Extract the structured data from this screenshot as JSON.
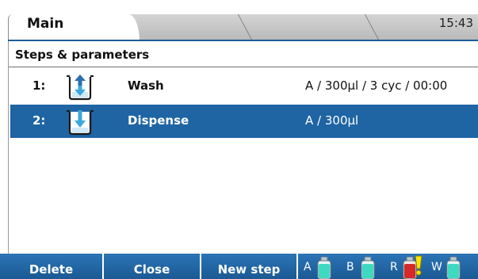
{
  "tabs": [
    {
      "label": "Main",
      "active": true
    },
    {
      "label": "",
      "active": false
    },
    {
      "label": "",
      "active": false
    },
    {
      "label": "",
      "active": false
    }
  ],
  "clock": "15:43",
  "section": {
    "title": "Steps & parameters"
  },
  "steps": [
    {
      "number": "1:",
      "icon": "wash-icon",
      "name": "Wash",
      "params": "A / 300µl / 3 cyc / 00:00",
      "selected": false
    },
    {
      "number": "2:",
      "icon": "dispense-icon",
      "name": "Dispense",
      "params": "A / 300µl",
      "selected": true
    }
  ],
  "softkeys": [
    {
      "label": "Delete"
    },
    {
      "label": "Close"
    },
    {
      "label": "New step"
    }
  ],
  "bottles": [
    {
      "label": "A",
      "color": "#3fd8c0",
      "status": "ok"
    },
    {
      "label": "B",
      "color": "#3fd8c0",
      "status": "ok"
    },
    {
      "label": "R",
      "color": "#d42a2a",
      "status": "warning"
    },
    {
      "label": "W",
      "color": "#3fd8c0",
      "status": "ok"
    }
  ],
  "colors": {
    "accent": "#1f64a3",
    "selection": "#1f64a3",
    "warning": "#ffe400",
    "reservoir": "#3fd8c0",
    "waste_full": "#d42a2a"
  }
}
